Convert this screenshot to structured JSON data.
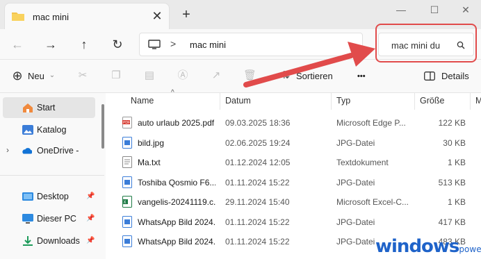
{
  "window": {
    "tab_title": "mac mini",
    "close_glyph": "✕",
    "new_tab_glyph": "+",
    "minimize_glyph": "—",
    "maximize_glyph": "☐",
    "close_window_glyph": "✕"
  },
  "nav": {
    "back": "←",
    "forward": "→",
    "up": "↑",
    "refresh": "↻",
    "breadcrumb_sep": ">",
    "location": "mac mini"
  },
  "search": {
    "value": "mac mini du"
  },
  "toolbar": {
    "new_label": "Neu",
    "sort_label": "Sortieren",
    "more": "•••",
    "details_label": "Details"
  },
  "sidebar": {
    "items": [
      {
        "label": "Start",
        "icon": "home-icon"
      },
      {
        "label": "Katalog",
        "icon": "gallery-icon"
      },
      {
        "label": "OneDrive - Perso",
        "icon": "onedrive-icon"
      },
      {
        "label": "Desktop",
        "icon": "desktop-icon"
      },
      {
        "label": "Dieser PC",
        "icon": "pc-icon"
      },
      {
        "label": "Downloads",
        "icon": "download-icon"
      }
    ]
  },
  "columns": {
    "name": "Name",
    "date": "Datum",
    "type": "Typ",
    "size": "Größe",
    "extra": "M"
  },
  "files": [
    {
      "name": "auto urlaub 2025.pdf",
      "date": "09.03.2025 18:36",
      "type": "Microsoft Edge P...",
      "size": "122 KB",
      "icon": "pdf-icon"
    },
    {
      "name": "bild.jpg",
      "date": "02.06.2025 19:24",
      "type": "JPG-Datei",
      "size": "30 KB",
      "icon": "image-icon"
    },
    {
      "name": "Ma.txt",
      "date": "01.12.2024 12:05",
      "type": "Textdokument",
      "size": "1 KB",
      "icon": "text-file-icon"
    },
    {
      "name": "Toshiba Qosmio F6...",
      "date": "01.11.2024 15:22",
      "type": "JPG-Datei",
      "size": "513 KB",
      "icon": "image-icon"
    },
    {
      "name": "vangelis-20241119.c...",
      "date": "29.11.2024 15:40",
      "type": "Microsoft Excel-C...",
      "size": "1 KB",
      "icon": "excel-icon"
    },
    {
      "name": "WhatsApp Bild 2024...",
      "date": "01.11.2024 15:22",
      "type": "JPG-Datei",
      "size": "417 KB",
      "icon": "image-icon"
    },
    {
      "name": "WhatsApp Bild 2024...",
      "date": "01.11.2024 15:22",
      "type": "JPG-Datei",
      "size": "483 KB",
      "icon": "image-icon"
    }
  ],
  "watermark": {
    "main": "windows",
    "suffix": "power"
  },
  "colors": {
    "accent": "#e14b4b",
    "folder": "#f4c34d",
    "logo": "#1f63c9"
  }
}
